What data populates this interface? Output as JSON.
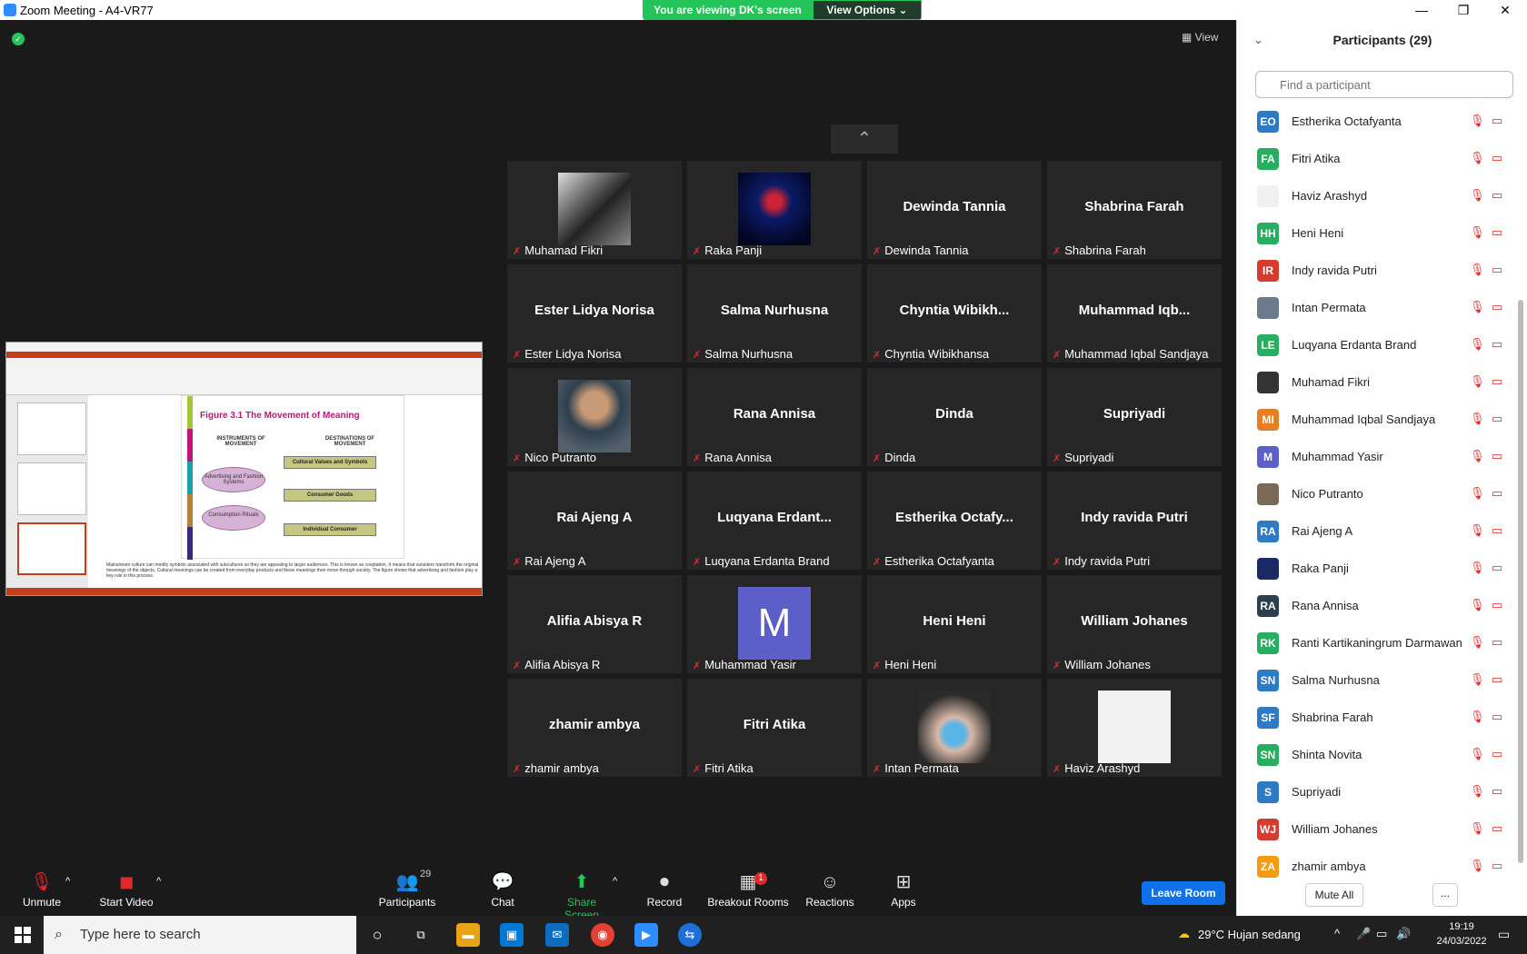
{
  "titlebar": {
    "title": "Zoom Meeting - A4-VR77",
    "minimize": "—",
    "restore": "❐",
    "close": "✕"
  },
  "banner": {
    "viewing": "You are viewing DK's screen",
    "view_options": "View Options ⌄"
  },
  "view_button": "View",
  "share": {
    "figure_title": "Figure 3.1 The Movement of Meaning",
    "instruments": "INSTRUMENTS OF MOVEMENT",
    "destinations": "DESTINATIONS OF MOVEMENT",
    "oval1": "Advertising and Fashion Systems",
    "oval2": "Consumption Rituals",
    "box1": "Cultural Values and Symbols",
    "box2": "Consumer Goods",
    "box3": "Individual Consumer",
    "caption": "Mainstream culture can modify symbols associated with subcultures so they are appealing to larger audiences. This is known as cooptation. It means that outsiders transform the original meanings of the objects. Cultural meanings can be created from everyday products and these meanings then move through society. The figure shows that advertising and fashion play a key role in this process."
  },
  "tiles": [
    {
      "big": "",
      "label": "Muhamad Fikri",
      "photo": "dark-poster"
    },
    {
      "big": "",
      "label": "Raka Panji",
      "photo": "blue-person"
    },
    {
      "big": "Dewinda Tannia",
      "label": "Dewinda Tannia"
    },
    {
      "big": "Shabrina Farah",
      "label": "Shabrina Farah"
    },
    {
      "big": "Ester Lidya Norisa",
      "label": "Ester Lidya Norisa"
    },
    {
      "big": "Salma Nurhusna",
      "label": "Salma Nurhusna"
    },
    {
      "big": "Chyntia  Wibikh...",
      "label": "Chyntia Wibikhansa"
    },
    {
      "big": "Muhammad  Iqb...",
      "label": "Muhammad Iqbal Sandjaya"
    },
    {
      "big": "",
      "label": "Nico Putranto",
      "photo": "man-portrait"
    },
    {
      "big": "Rana Annisa",
      "label": "Rana Annisa"
    },
    {
      "big": "Dinda",
      "label": "Dinda"
    },
    {
      "big": "Supriyadi",
      "label": "Supriyadi"
    },
    {
      "big": "Rai Ajeng A",
      "label": "Rai Ajeng A"
    },
    {
      "big": "Luqyana  Erdant...",
      "label": "Luqyana Erdanta Brand"
    },
    {
      "big": "Estherika  Octafy...",
      "label": "Estherika Octafyanta"
    },
    {
      "big": "Indy ravida Putri",
      "label": "Indy ravida Putri"
    },
    {
      "big": "Alifia Abisya R",
      "label": "Alifia Abisya R"
    },
    {
      "big": "",
      "label": "Muhammad Yasir",
      "photo": "letter-m",
      "letter": "M"
    },
    {
      "big": "Heni Heni",
      "label": "Heni Heni"
    },
    {
      "big": "William Johanes",
      "label": "William Johanes"
    },
    {
      "big": "zhamir ambya",
      "label": "zhamir ambya"
    },
    {
      "big": "Fitri Atika",
      "label": "Fitri Atika"
    },
    {
      "big": "",
      "label": "Intan Permata",
      "photo": "masked-woman"
    },
    {
      "big": "",
      "label": "Haviz Arashyd",
      "photo": "white-blank"
    }
  ],
  "panel": {
    "title": "Participants (29)",
    "search_placeholder": "Find a participant",
    "participants": [
      {
        "initials": "EO",
        "name": "Estherika Octafyanta",
        "color": "#2d7bc4"
      },
      {
        "initials": "FA",
        "name": "Fitri Atika",
        "color": "#27ae60"
      },
      {
        "initials": "",
        "name": "Haviz Arashyd",
        "color": "#f0f0f0"
      },
      {
        "initials": "HH",
        "name": "Heni Heni",
        "color": "#27ae60"
      },
      {
        "initials": "IR",
        "name": "Indy ravida Putri",
        "color": "#d63b2f"
      },
      {
        "initials": "",
        "name": "Intan Permata",
        "color": "#6b7b8c"
      },
      {
        "initials": "LE",
        "name": "Luqyana Erdanta Brand",
        "color": "#27ae60"
      },
      {
        "initials": "",
        "name": "Muhamad Fikri",
        "color": "#333333"
      },
      {
        "initials": "MI",
        "name": "Muhammad Iqbal Sandjaya",
        "color": "#e67e22"
      },
      {
        "initials": "M",
        "name": "Muhammad Yasir",
        "color": "#5b5fc7"
      },
      {
        "initials": "",
        "name": "Nico Putranto",
        "color": "#7a6a55"
      },
      {
        "initials": "RA",
        "name": "Rai Ajeng A",
        "color": "#2d7bc4"
      },
      {
        "initials": "",
        "name": "Raka Panji",
        "color": "#1b2a66"
      },
      {
        "initials": "RA",
        "name": "Rana Annisa",
        "color": "#2c3e50"
      },
      {
        "initials": "RK",
        "name": "Ranti Kartikaningrum Darmawan",
        "color": "#27ae60"
      },
      {
        "initials": "SN",
        "name": "Salma Nurhusna",
        "color": "#2d7bc4"
      },
      {
        "initials": "SF",
        "name": "Shabrina Farah",
        "color": "#2d7bc4"
      },
      {
        "initials": "SN",
        "name": "Shinta Novita",
        "color": "#27ae60"
      },
      {
        "initials": "S",
        "name": "Supriyadi",
        "color": "#2d7bc4"
      },
      {
        "initials": "WJ",
        "name": "William Johanes",
        "color": "#d63b2f"
      },
      {
        "initials": "ZA",
        "name": "zhamir ambya",
        "color": "#f39c12"
      }
    ],
    "mute_all": "Mute All",
    "more": "..."
  },
  "toolbar": {
    "unmute": "Unmute",
    "start_video": "Start Video",
    "participants": "Participants",
    "participants_count": "29",
    "chat": "Chat",
    "share_screen": "Share Screen",
    "record": "Record",
    "breakout_rooms": "Breakout Rooms",
    "breakout_badge": "1",
    "reactions": "Reactions",
    "apps": "Apps",
    "leave": "Leave Room"
  },
  "taskbar": {
    "search_placeholder": "Type here to search",
    "weather": "29°C  Hujan sedang",
    "time": "19:19",
    "date": "24/03/2022"
  }
}
